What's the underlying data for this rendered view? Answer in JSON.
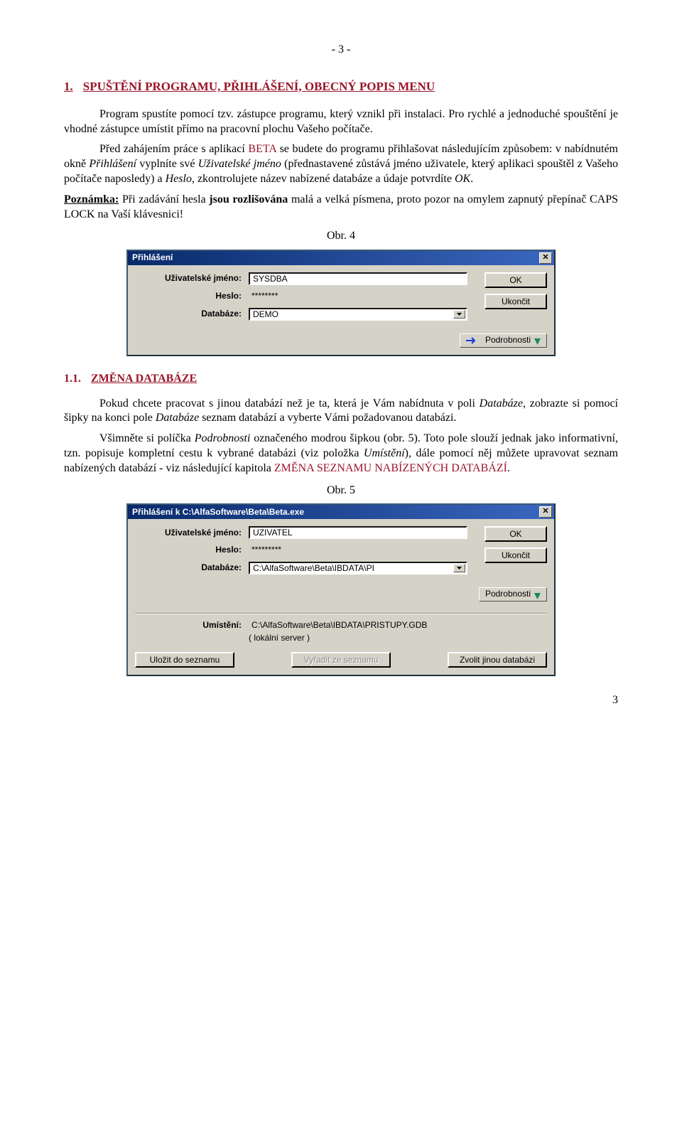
{
  "page": {
    "top_num": "- 3 -",
    "bottom_num": "3"
  },
  "h1": {
    "num": "1.",
    "title": "SPUŠTĚNÍ PROGRAMU, PŘIHLÁŠENÍ, OBECNÝ POPIS MENU"
  },
  "p1": "Program spustíte pomocí tzv. zástupce programu, který vznikl při instalaci. Pro rychlé a jednoduché spouštění je vhodné zástupce umístit přímo na pracovní plochu Vašeho počítače.",
  "p2a": "Před zahájením práce s aplikací ",
  "p2_beta": "BETA",
  "p2b": " se budete do programu přihlašovat následujícím způsobem: v nabídnutém okně ",
  "p2c": "Přihlášení",
  "p2d": " vyplníte své ",
  "p2e": "Uživatelské jméno",
  "p2f": " (přednastavené zůstává jméno uživatele, který aplikaci spouštěl z Vašeho počítače naposledy) a ",
  "p2g": "Heslo",
  "p2h": ", zkontrolujete název nabízené databáze a údaje potvrdíte ",
  "p2i": "OK",
  "p2j": ".",
  "note_label": "Poznámka:",
  "note_a": " Při zadávání hesla ",
  "note_b": "jsou rozlišována",
  "note_c": " malá a velká písmena, proto pozor na omylem zapnutý přepínač CAPS LOCK na Vaší klávesnici!",
  "fig4": "Obr. 4",
  "dlg1": {
    "title": "Přihlášení",
    "user_label": "Uživatelské jméno:",
    "user_value": "SYSDBA",
    "pass_label": "Heslo:",
    "pass_value": "********",
    "db_label": "Databáze:",
    "db_value": "DEMO",
    "ok": "OK",
    "cancel": "Ukončit",
    "details": "Podrobnosti"
  },
  "h11": {
    "num": "1.1.",
    "title": "ZMĚNA DATABÁZE"
  },
  "p3a": "Pokud chcete pracovat s jinou databází než je ta, která je Vám nabídnuta v poli ",
  "p3b": "Databáze",
  "p3c": ", zobrazte si pomocí šipky na konci pole ",
  "p3d": "Databáze",
  "p3e": " seznam databází a vyberte Vámi požadovanou databázi.",
  "p4a": "Všimněte si políčka ",
  "p4b": "Podrobnosti",
  "p4c": " označeného modrou šipkou (obr. 5). Toto pole slouží jednak jako informativní, tzn. popisuje kompletní cestu k vybrané databázi (viz položka ",
  "p4d": "Umístění",
  "p4e": "), dále pomocí něj můžete upravovat seznam nabízených databází - viz následující kapitola ",
  "p4f": "ZMĚNA SEZNAMU NABÍZENÝCH DATABÁZÍ",
  "p4g": ".",
  "fig5": "Obr. 5",
  "dlg2": {
    "title": "Přihlášení k C:\\AlfaSoftware\\Beta\\Beta.exe",
    "user_label": "Uživatelské jméno:",
    "user_value": "UZIVATEL",
    "pass_label": "Heslo:",
    "pass_value": "*********",
    "db_label": "Databáze:",
    "db_value": "C:\\AlfaSoftware\\Beta\\IBDATA\\PI",
    "ok": "OK",
    "cancel": "Ukončit",
    "details": "Podrobnosti",
    "loc_label": "Umístění:",
    "loc_value": "C:\\AlfaSoftware\\Beta\\IBDATA\\PRISTUPY.GDB",
    "loc_sub": "( lokální server )",
    "btn_save": "Uložit do seznamu",
    "btn_remove": "Vyřadit ze seznamu",
    "btn_choose": "Zvolit jinou databázi"
  }
}
